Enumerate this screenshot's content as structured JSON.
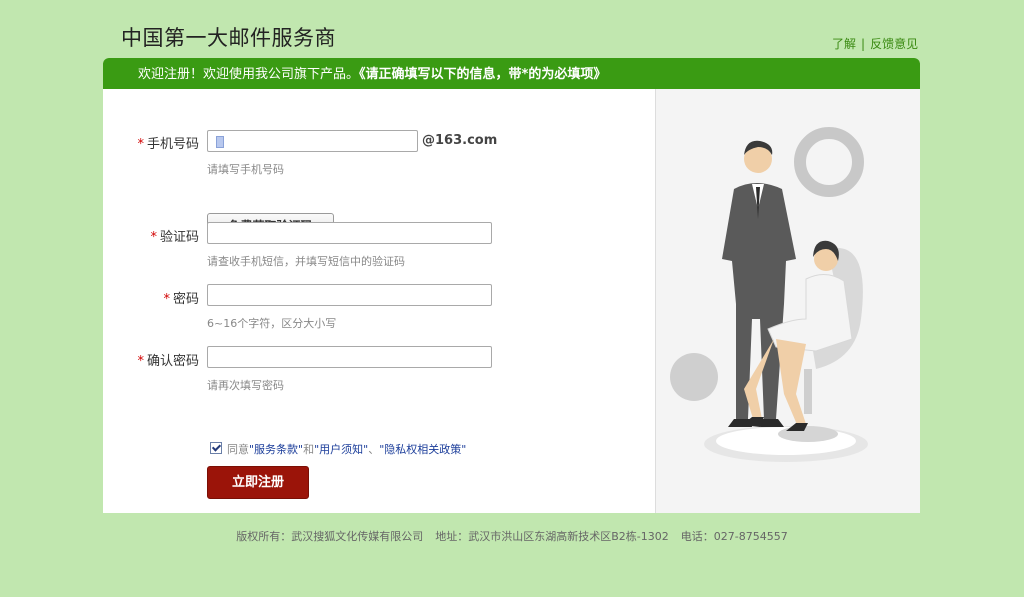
{
  "header": {
    "brand": "中国第一大邮件服务商",
    "links": [
      "了解",
      "反馈意见"
    ],
    "separator": "|"
  },
  "banner": {
    "intro": "欢迎注册！欢迎使用我公司旗下产品。",
    "emphasis": "《请正确填写以下的信息，带*的为必填项》"
  },
  "form": {
    "phone": {
      "required": "*",
      "label": "手机号码",
      "value": "",
      "suffix": "@163.com",
      "hint": "请填写手机号码"
    },
    "get_code_button": "免费获取验证码",
    "code": {
      "required": "*",
      "label": "验证码",
      "value": "",
      "hint": "请查收手机短信，并填写短信中的验证码"
    },
    "password": {
      "required": "*",
      "label": "密码",
      "value": "",
      "hint": "6~16个字符，区分大小写"
    },
    "confirm": {
      "required": "*",
      "label": "确认密码",
      "value": "",
      "hint": "请再次填写密码"
    },
    "agree": {
      "checked": true,
      "prefix": "同意",
      "terms": "\"服务条款\"",
      "and": "和",
      "user_notice": "\"用户须知\"",
      "comma": "、",
      "privacy": "\"隐私权相关政策\""
    },
    "submit_button": "立即注册"
  },
  "footer": {
    "copyright": "版权所有：武汉搜狐文化传媒有限公司",
    "address": "地址：武汉市洪山区东湖高新技术区B2栋-1302",
    "phone": "电话：027-8754557"
  },
  "colors": {
    "page_bg": "#c1e7af",
    "banner_green": "#3a9b13",
    "submit_red": "#9b1409",
    "required_red": "#d10000",
    "link_blue": "#1b3d9a"
  }
}
